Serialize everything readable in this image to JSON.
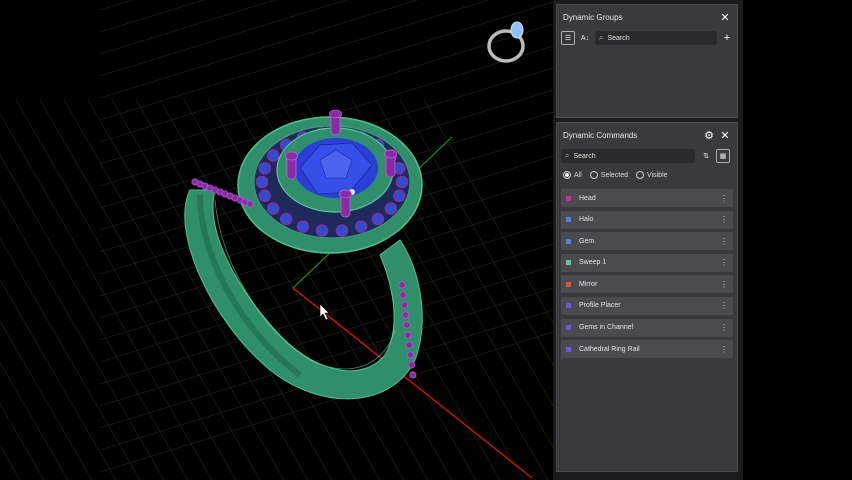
{
  "groups_panel": {
    "title": "Dynamic Groups",
    "close_icon": "close-icon",
    "search_placeholder": "Search",
    "add_icon": "plus-icon"
  },
  "commands_panel": {
    "title": "Dynamic Commands",
    "settings_icon": "gear-icon",
    "close_icon": "close-icon",
    "search_placeholder": "Search",
    "filters": [
      {
        "label": "All",
        "selected": true
      },
      {
        "label": "Selected",
        "selected": false
      },
      {
        "label": "Visible",
        "selected": false
      }
    ],
    "items": [
      {
        "label": "Head",
        "color": "#c0359a"
      },
      {
        "label": "Halo",
        "color": "#5b7fd6"
      },
      {
        "label": "Gem",
        "color": "#5b7fd6"
      },
      {
        "label": "Sweep 1",
        "color": "#63c2a6"
      },
      {
        "label": "Mirror",
        "color": "#d25b3c"
      },
      {
        "label": "Profile Placer",
        "color": "#6a5ad9"
      },
      {
        "label": "Gems in Channel",
        "color": "#6a5ad9"
      },
      {
        "label": "Cathedral Ring Rail",
        "color": "#6a5ad9"
      }
    ]
  },
  "viewport": {
    "ring_band_color": "#2f8f6b",
    "gem_color": "#2a3fd8",
    "prong_color": "#8a2aa5",
    "x_axis_color": "#e01010",
    "y_axis_color": "#1a9a2a"
  }
}
